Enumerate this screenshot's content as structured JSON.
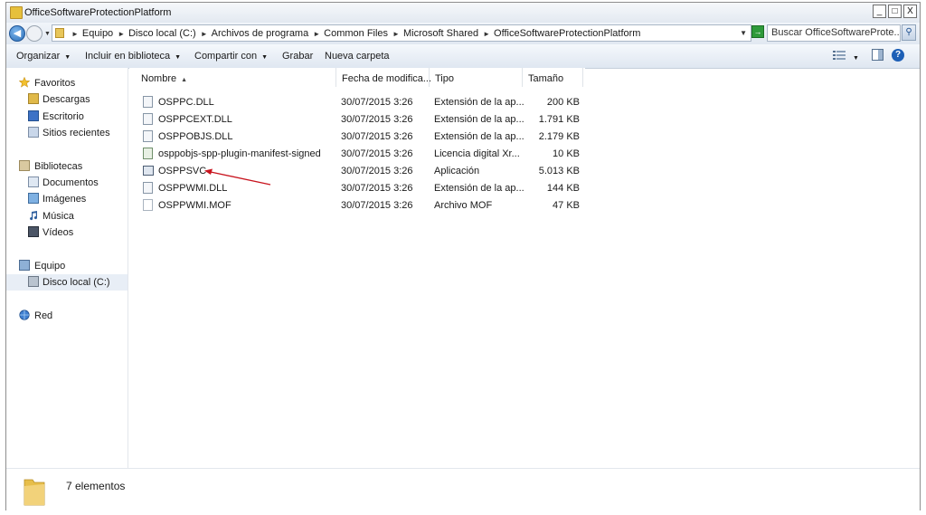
{
  "window": {
    "title": "OfficeSoftwareProtectionPlatform",
    "buttons": {
      "minimize": "_",
      "maximize": "□",
      "close": "X"
    }
  },
  "address": {
    "crumbs": [
      "Equipo",
      "Disco local (C:)",
      "Archivos de programa",
      "Common Files",
      "Microsoft Shared",
      "OfficeSoftwareProtectionPlatform"
    ],
    "search_placeholder": "Buscar OfficeSoftwareProte..."
  },
  "toolbar": {
    "organize": "Organizar",
    "include_library": "Incluir en biblioteca",
    "share": "Compartir con",
    "burn": "Grabar",
    "new_folder": "Nueva carpeta"
  },
  "sidebar": {
    "favorites": "Favoritos",
    "downloads": "Descargas",
    "desktop": "Escritorio",
    "recent": "Sitios recientes",
    "libraries": "Bibliotecas",
    "documents": "Documentos",
    "images": "Imágenes",
    "music": "Música",
    "videos": "Vídeos",
    "computer": "Equipo",
    "local_disk": "Disco local (C:)",
    "network": "Red"
  },
  "columns": {
    "name": "Nombre",
    "date": "Fecha de modifica...",
    "type": "Tipo",
    "size": "Tamaño"
  },
  "files": [
    {
      "name": "OSPPC.DLL",
      "date": "30/07/2015 3:26",
      "type": "Extensión de la ap...",
      "size": "200 KB"
    },
    {
      "name": "OSPPCEXT.DLL",
      "date": "30/07/2015 3:26",
      "type": "Extensión de la ap...",
      "size": "1.791 KB"
    },
    {
      "name": "OSPPOBJS.DLL",
      "date": "30/07/2015 3:26",
      "type": "Extensión de la ap...",
      "size": "2.179 KB"
    },
    {
      "name": "osppobjs-spp-plugin-manifest-signed",
      "date": "30/07/2015 3:26",
      "type": "Licencia digital Xr...",
      "size": "10 KB"
    },
    {
      "name": "OSPPSVC",
      "date": "30/07/2015 3:26",
      "type": "Aplicación",
      "size": "5.013 KB"
    },
    {
      "name": "OSPPWMI.DLL",
      "date": "30/07/2015 3:26",
      "type": "Extensión de la ap...",
      "size": "144 KB"
    },
    {
      "name": "OSPPWMI.MOF",
      "date": "30/07/2015 3:26",
      "type": "Archivo MOF",
      "size": "47 KB"
    }
  ],
  "status": {
    "count": "7 elementos"
  },
  "colors": {
    "annotation_arrow": "#c8141e",
    "accent": "#1d5fb6"
  }
}
